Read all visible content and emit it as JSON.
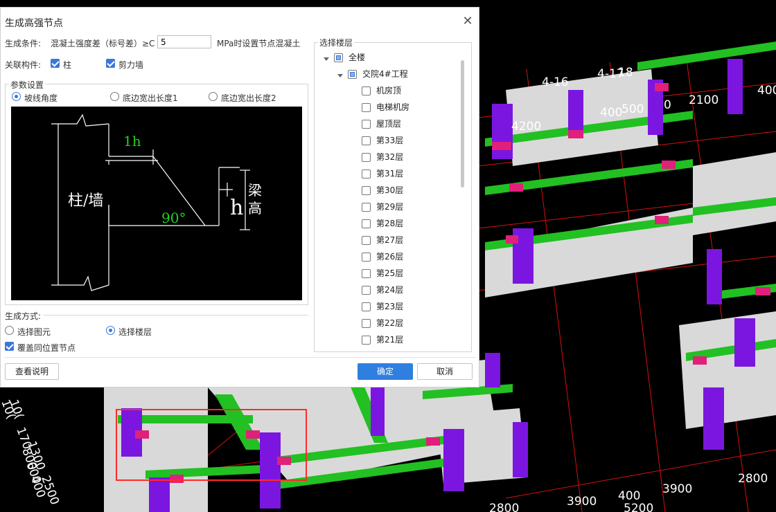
{
  "colors": {
    "accent": "#2f7fe0",
    "beam": "#22c022",
    "column": "#7b16e0",
    "joint": "#e0207a",
    "slab": "#d8d8d8",
    "grid": "#e01010"
  },
  "dialog": {
    "title": "生成高强节点",
    "condition": {
      "label": "生成条件:",
      "text_before": "混凝土强度差（标号差）≥C",
      "value": "5",
      "text_after": "MPa时设置节点混凝土"
    },
    "linked": {
      "label": "关联构件:",
      "column": "柱",
      "wall": "剪力墙"
    },
    "params": {
      "title": "参数设置",
      "options": [
        "坡线角度",
        "底边宽出长度1",
        "底边宽出长度2"
      ],
      "selected": 0,
      "diagram": {
        "column_wall": "柱/墙",
        "offset": "1h",
        "angle": "90°",
        "h": "h",
        "beam_height": [
          "梁",
          "高"
        ]
      }
    },
    "method": {
      "title": "生成方式:",
      "options": [
        "选择图元",
        "选择楼层"
      ],
      "selected": 1,
      "overwrite": "覆盖同位置节点"
    },
    "buttons": {
      "help": "查看说明",
      "ok": "确定",
      "cancel": "取消"
    },
    "floors": {
      "title": "选择楼层",
      "root": "全楼",
      "project": "交院4#工程",
      "items": [
        "机房顶",
        "电梯机房",
        "屋顶层",
        "第33层",
        "第32层",
        "第31层",
        "第30层",
        "第29层",
        "第28层",
        "第27层",
        "第26层",
        "第25层",
        "第24层",
        "第23层",
        "第22层",
        "第21层"
      ]
    }
  },
  "cad_labels": {
    "top": [
      "4-16",
      "4-17",
      "18",
      "400",
      "500",
      "0",
      "2100",
      "400",
      "4200"
    ],
    "bottom": [
      "3900",
      "400",
      "3900",
      "2800",
      "2800",
      "1300",
      "2500",
      "5200"
    ],
    "left_stack": [
      "10(",
      "10(",
      "170",
      "800",
      "600",
      "400"
    ]
  }
}
